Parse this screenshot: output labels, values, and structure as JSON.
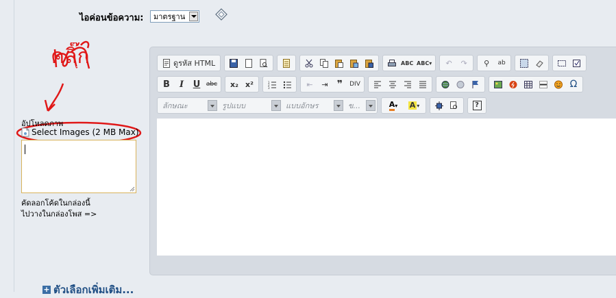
{
  "post_icon": {
    "label": "ไอค่อนข้อความ:",
    "selected": "มาตรฐาน"
  },
  "annotation": {
    "text": "คลิ๊ก"
  },
  "upload": {
    "label": "อัปโหลดภาพ",
    "select_button": "Select Images (2 MB Max)",
    "hint_line1": "คัดลอกโค้ดในกล่องนี้",
    "hint_line2": "ไปวางในกล่องโพส =>"
  },
  "editor": {
    "toolbar_row1": {
      "source_button": "ดูรหัส HTML",
      "icons": [
        "save-icon",
        "new-page-icon",
        "preview-icon",
        "templates-icon",
        "cut-icon",
        "copy-icon",
        "paste-icon",
        "paste-text-icon",
        "paste-word-icon",
        "print-icon",
        "spellcheck-icon",
        "spellcheck-as-you-type-icon",
        "undo-icon",
        "redo-icon",
        "find-icon",
        "replace-icon",
        "select-all-icon",
        "remove-format-icon",
        "form-icon",
        "checkbox-icon"
      ]
    },
    "toolbar_row2": {
      "bold": "B",
      "italic": "I",
      "underline": "U",
      "strike": "abc"
    },
    "toolbar_row3": {
      "style_combo": "ลักษณะ",
      "format_combo": "รูปแบบ",
      "font_combo": "แบบอักษร",
      "size_combo": "ข..."
    }
  },
  "more_options": {
    "label": "ตัวเลือกเพิ่มเติม..."
  }
}
